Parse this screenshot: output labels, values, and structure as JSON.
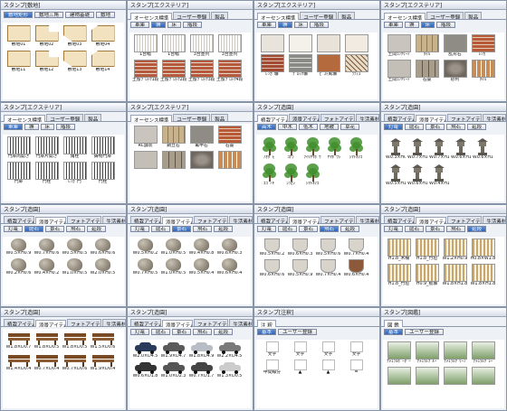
{
  "panels": [
    {
      "title": "スタンプ[敷地]",
      "tabs": [],
      "cats": [
        "敷地矩形",
        "敷地三角",
        "建物基礎",
        "敷地"
      ],
      "activeCat": 0,
      "kind": "site",
      "items": [
        "敷地01",
        "敷地02",
        "敷地03",
        "敷地04",
        "敷地11",
        "敷地12",
        "敷地13",
        "敷地14"
      ]
    },
    {
      "title": "スタンプ[エクステリア]",
      "tabs": [
        "オーセンス標準",
        "ユーザー登録",
        "製品"
      ],
      "cats": [
        "車庫",
        "塀",
        "床",
        "階段"
      ],
      "activeCat": 1,
      "kind": "fence",
      "items": [
        "1台幅",
        "1台幅",
        "3台並列",
        "3台並列",
        "土留ﾌﾞﾛｯｸ1段",
        "土留ﾌﾞﾛｯｸ2段",
        "土留ﾌﾞﾛｯｸ3段",
        "土留ﾌﾞﾛｯｸ4段"
      ]
    },
    {
      "title": "スタンプ[エクステリア]",
      "tabs": [
        "オーセンス標準",
        "ユーザー登録",
        "製品"
      ],
      "cats": [
        "車庫",
        "塀",
        "床",
        "階段"
      ],
      "activeCat": 1,
      "kind": "wall",
      "items": [
        "",
        "",
        "",
        "",
        "ﾚﾝｶﾞ塀",
        "ﾌﾞﾛｯｸ塀",
        "ﾋﾞｽﾄ風塀",
        "ﾗﾃｨｽ"
      ]
    },
    {
      "title": "スタンプ[エクステリア]",
      "tabs": [
        "オーセンス標準",
        "ユーザー登録",
        "製品"
      ],
      "cats": [
        "車庫",
        "塀",
        "床",
        "階段"
      ],
      "activeCat": 2,
      "kind": "floor",
      "items": [
        "土間ｺﾝｸﾘｰﾄ",
        "ﾀｲﾙ",
        "乱形石",
        "ﾚﾝｶﾞ",
        "土間ｺﾝｸﾘｰﾄ",
        "石畳",
        "砂利",
        "ﾀｲﾙ"
      ]
    },
    {
      "title": "スタンプ[エクステリア]",
      "tabs": [
        "オーセンス標準",
        "ユーザー登録",
        "製品"
      ],
      "cats": [
        "車庫",
        "塀",
        "床",
        "階段"
      ],
      "activeCat": 0,
      "kind": "gate",
      "items": [
        "門扉両開き",
        "門扉片開き",
        "角柱",
        "鋳物門扉",
        "門扉",
        "門柱",
        "ﾚﾝｶﾞ門",
        "門柱"
      ]
    },
    {
      "title": "スタンプ[エクステリア]",
      "tabs": [
        "オーセンス標準",
        "ユーザー登録",
        "製品"
      ],
      "cats": [],
      "activeCat": -1,
      "kind": "pave",
      "items": [
        "RC舗装",
        "鋼立石",
        "亀甲石",
        "石畳",
        "",
        "",
        "",
        ""
      ]
    },
    {
      "title": "スタンプ[造園]",
      "tabs": [
        "植栽アイテム",
        "添景アイテム",
        "フォトアイテム",
        "生活素材"
      ],
      "cats": [
        "高木",
        "中木",
        "低木",
        "地被",
        "草花"
      ],
      "activeCat": 0,
      "kind": "tree",
      "items": [
        "ｱｵﾀﾞﾓ",
        "ｺﾅﾗ",
        "ﾌｲﾘﾔﾏﾎﾞｳ",
        "ﾔﾏﾎﾞｳｼ",
        "ｼﾏﾄﾈﾘｺ",
        "ｴｺﾞﾉｷ",
        "ｼﾗｶｼ",
        "ｼﾏﾄﾈﾘｺ"
      ]
    },
    {
      "title": "スタンプ[造園]",
      "tabs": [
        "植栽アイテム",
        "添景アイテム",
        "フォトアイテム",
        "生活素材"
      ],
      "cats": [
        "灯篭",
        "庭石",
        "景石",
        "飛石",
        "延段"
      ],
      "activeCat": 0,
      "kind": "lantern",
      "items": [
        "W0.3×H0.6",
        "W0.7×H1.1",
        "W0.7×H1.2",
        "W0.6×H1.1",
        "W0.6×H1.2",
        "W0.5×H1.0",
        "W0.6×H1.1",
        "W0.4×H1.1"
      ]
    },
    {
      "title": "スタンプ[造園]",
      "tabs": [
        "植栽アイテム",
        "添景アイテム",
        "フォトアイテム",
        "生活素材"
      ],
      "cats": [
        "灯篭",
        "庭石",
        "景石",
        "飛石",
        "延段"
      ],
      "activeCat": 1,
      "kind": "rock",
      "items": [
        "W0.5×H0.9",
        "W0.7×H0.6",
        "W0.5×H0.5",
        "W0.6×H0.6",
        "W0.2×H0.6",
        "W0.4×H0.2",
        "W1.0×H0.5",
        "W2.0×H0.5"
      ]
    },
    {
      "title": "スタンプ[造園]",
      "tabs": [
        "植栽アイテム",
        "添景アイテム",
        "フォトアイテム",
        "生活素材"
      ],
      "cats": [
        "灯篭",
        "庭石",
        "景石",
        "飛石",
        "延段"
      ],
      "activeCat": 2,
      "kind": "rock",
      "items": [
        "W0.5×H0.2",
        "W1.0×H0.5",
        "W0.4×H0.8",
        "W0.6×H0.3",
        "W0.7×H0.5",
        "W1.0×H0.5",
        "W0.5×H0.4",
        "W0.6×H0.4"
      ]
    },
    {
      "title": "スタンプ[造園]",
      "tabs": [
        "植栽アイテム",
        "添景アイテム",
        "フォトアイテム",
        "生活素材"
      ],
      "cats": [
        "灯篭",
        "庭石",
        "景石",
        "飛石",
        "延段"
      ],
      "activeCat": 3,
      "kind": "pot",
      "items": [
        "W0.5×H0.2",
        "W0.6×H0.3",
        "W0.5×H0.6",
        "W0.7×H0.4",
        "W0.6×H0.6",
        "W0.5×H0.9",
        "W0.7×H0.4",
        "W0.6×H0.4"
      ]
    },
    {
      "title": "スタンプ[造園]",
      "tabs": [
        "植栽アイテム",
        "添景アイテム",
        "フォトアイテム",
        "生活素材"
      ],
      "cats": [
        "灯篭",
        "庭石",
        "景石",
        "飛石",
        "延段"
      ],
      "activeCat": 4,
      "kind": "fence2",
      "items": [
        "H1.8_木柵",
        "H1.8_竹垣",
        "W1.2×H0.9",
        "H0.8×W1.8",
        "H1.8_竹垣",
        "H0.9_板塀",
        "W1.8×H1.8",
        "W1.8×H1.8"
      ]
    },
    {
      "title": "スタンプ[造園]",
      "tabs": [
        "植栽アイテム",
        "添景アイテム",
        "フォトアイテム",
        "生活素材"
      ],
      "cats": [],
      "activeCat": -1,
      "kind": "bench",
      "items": [
        "W1.8×D0.7",
        "W1.8×D0.5",
        "W1.8×D0.5",
        "W1.5×D0.6",
        "W1.4×D0.4",
        "W0.7×D0.4",
        "W0.7×D0.6",
        "W1.9×D0.4"
      ]
    },
    {
      "title": "スタンプ[造園]",
      "tabs": [
        "植栽アイテム",
        "添景アイテム",
        "フォトアイテム",
        "生活素材"
      ],
      "cats": [
        "灯篭",
        "庭石",
        "景石",
        "飛石",
        "延段"
      ],
      "activeCat": -1,
      "kind": "car",
      "items": [
        "W2.0×D4.5",
        "W1.9×D4.7",
        "W1.8×D4.9",
        "W2.2×D4.5",
        "W0.6×D1.8",
        "W1.0×D2.3",
        "W0.7×D1.7",
        "W1.3×D0.5"
      ]
    },
    {
      "title": "スタンプ[注釈]",
      "tabs": [
        "注 釈"
      ],
      "cats": [
        "基本",
        "ユーザー登録"
      ],
      "activeCat": 0,
      "kind": "note",
      "items": [
        "文字",
        "文字",
        "文字",
        "文字",
        "中間線分",
        "▲",
        "▲",
        "="
      ]
    },
    {
      "title": "スタンプ[図鑑]",
      "tabs": [
        "図 鑑"
      ],
      "cats": [
        "基本",
        "ユーザー登録"
      ],
      "activeCat": 0,
      "kind": "photo",
      "items": [
        "ﾅﾁｭﾗﾙﾎﾞｰﾀﾞｰ",
        "ﾅﾁｭﾗﾙﾌﾞﾙｰ",
        "ﾅﾁｭﾗﾙｸﾞﾘｰﾝ",
        "ﾅﾁｭﾗﾙｸﾞﾚｰ",
        "",
        "",
        "",
        ""
      ]
    }
  ]
}
